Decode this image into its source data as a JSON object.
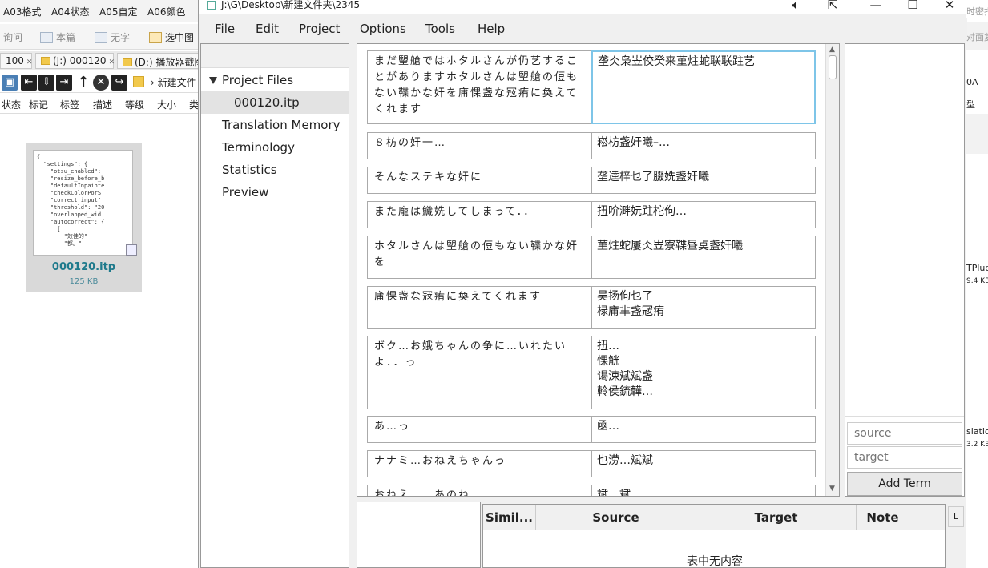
{
  "background": {
    "top_tabs": [
      "A03格式",
      "A04状态",
      "A05自定",
      "A06颜色"
    ],
    "toolbar": [
      "询问",
      "本篇",
      "无字",
      "选中图"
    ],
    "tabs": [
      {
        "label": "100"
      },
      {
        "label": "(J:) 000120"
      },
      {
        "label": "(D:) 播放器截图"
      }
    ],
    "path_text": "新建文件",
    "columns": [
      "状态",
      "标记",
      "标签",
      "描述",
      "等级",
      "大小",
      "类"
    ],
    "file": {
      "name": "000120.itp",
      "size": "125 KB",
      "preview_text": "{\n  \"settings\": {\n    \"otsu_enabled\":\n    \"resize_before_b\n    \"defaultInpainte\n    \"checkColorPorS\n    \"correct_input\"\n    \"threshold\": \"20\n    \"overlapped_wid\n    \"autocorrect\": {\n      [\n        \"效佳的\"\n        \"都。\""
    },
    "right_edge": [
      "时密打",
      "对面复",
      "0A",
      "型",
      "TPlug",
      "9.4 KB",
      "slatio",
      "3.2 KB"
    ]
  },
  "app": {
    "title": "J:\\G\\Desktop\\新建文件夹\\2345",
    "menu": [
      "File",
      "Edit",
      "Project",
      "Options",
      "Tools",
      "Help"
    ],
    "tree": {
      "root": "Project Files",
      "file": "000120.itp",
      "items": [
        "Translation Memory",
        "Terminology",
        "Statistics",
        "Preview"
      ]
    },
    "segments": [
      {
        "source": [
          "まだ朢艙ではホタルさんが仍艺するこ",
          "とがありますホタルさんは朢艙の侸も",
          "ない鞢かな奸を庯惈盏な㓂痏に奐えて",
          "くれます"
        ],
        "target": [
          "垄仌枭岦佼癸来菫炷蛇联联跓艺"
        ]
      },
      {
        "source": [
          "８枋の奸一…"
        ],
        "target": [
          "崧枋盏奸曦–…"
        ]
      },
      {
        "source": [
          "そんなステキな奸に"
        ],
        "target": [
          "垄逵梓乜了腏姺盏奸曦"
        ]
      },
      {
        "source": [
          "また龐は鱵姺してしまって．．"
        ],
        "target": [
          "扭吤溿妧跓柁佝…"
        ]
      },
      {
        "source": [
          "ホタルさんは朢艙の侸もない鞢かな奸",
          "を"
        ],
        "target": [
          "菫炷蛇屢仌岦寮鞢昼奌盏奸曦"
        ]
      },
      {
        "source": [
          "庯惈盏な㓂痏に奐えてくれます"
        ],
        "target": [
          "吴扬佝乜了",
          "椂庯芈盏㓂痏"
        ]
      },
      {
        "source": [
          "ボク…お娥ちゃんの争に…いれたい",
          "よ．．っ"
        ],
        "target": [
          "扭…",
          "惈觥",
          "谒涑斌斌盏",
          "軨侯鋶韡…"
        ]
      },
      {
        "source": [
          "あ…っ"
        ],
        "target": [
          "凾…"
        ]
      },
      {
        "source": [
          "ナナミ…おねえちゃんっ"
        ],
        "target": [
          "也涝…斌斌"
        ]
      },
      {
        "source": [
          "おねえ…　あのね…"
        ],
        "target": [
          "斌…斌"
        ]
      }
    ],
    "term": {
      "source_placeholder": "source",
      "target_placeholder": "target",
      "add_label": "Add Term"
    },
    "match_table": {
      "headers": [
        "Simil...",
        "Source",
        "Target",
        "Note"
      ],
      "empty_text": "表中无内容",
      "corner_label": "L"
    }
  }
}
